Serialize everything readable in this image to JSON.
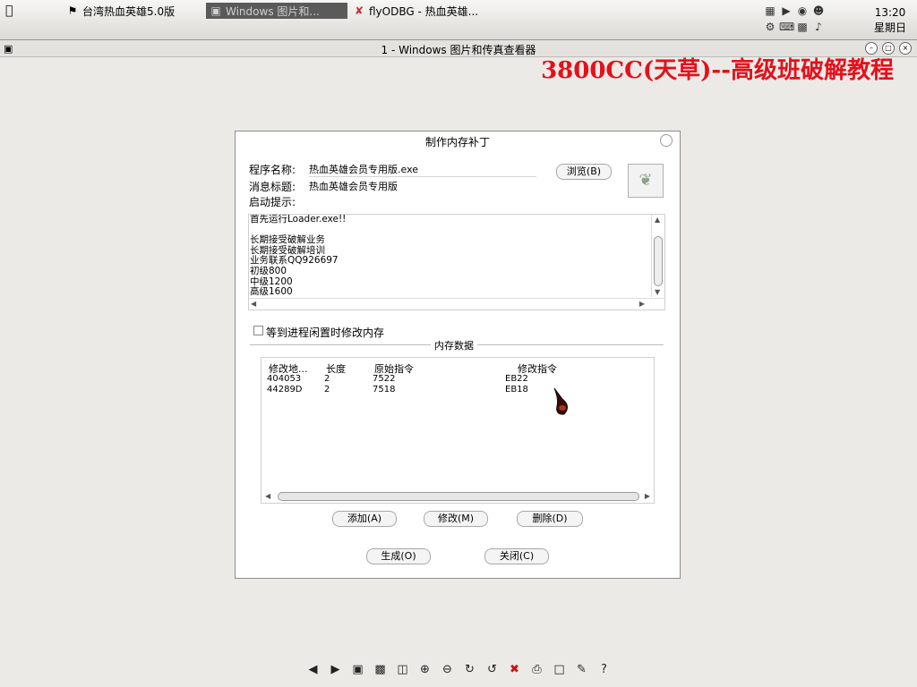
{
  "taskbar": {
    "tasks": [
      {
        "label": "台湾热血英雄5.0版",
        "icon": "flag-icon"
      },
      {
        "label": "Windows 图片和...",
        "icon": "image-viewer-icon"
      },
      {
        "label": "flyODBG - 热血英雄...",
        "icon": "debugger-icon"
      }
    ],
    "clock": {
      "time": "13:20",
      "day": "星期日"
    }
  },
  "viewer": {
    "title": "1 - Windows 图片和传真查看器",
    "banner": "3800CC(天草)--高级班破解教程",
    "banner_color": "#e4101a"
  },
  "dialog": {
    "title": "制作内存补丁",
    "program_name_label": "程序名称:",
    "program_name_value": "热血英雄会员专用版.exe",
    "message_title_label": "消息标题:",
    "message_title_value": "热血英雄会员专用版",
    "startup_hint_label": "启动提示:",
    "browse_button": "浏览(B)",
    "memo_lines": [
      "首先运行Loader.exe!!",
      "",
      "长期接受破解业务",
      "长期接受破解培训",
      "业务联系QQ926697",
      "初级800",
      "中级1200",
      "高级1600"
    ],
    "wait_checkbox_label": "等到进程闲置时修改内存",
    "group_label": "内存数据",
    "table": {
      "headers": [
        "修改地...",
        "长度",
        "原始指令",
        "修改指令"
      ],
      "rows": [
        [
          "404053",
          "2",
          "7522",
          "EB22"
        ],
        [
          "44289D",
          "2",
          "7518",
          "EB18"
        ]
      ]
    },
    "add_button": "添加(A)",
    "modify_button": "修改(M)",
    "delete_button": "删除(D)",
    "generate_button": "生成(O)",
    "close_button": "关闭(C)"
  }
}
